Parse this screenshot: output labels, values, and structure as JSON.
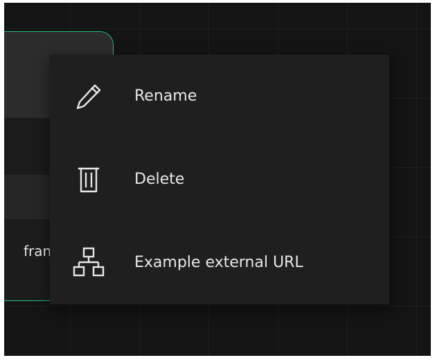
{
  "node": {
    "label": "fran"
  },
  "context_menu": {
    "items": [
      {
        "label": "Rename",
        "icon": "pencil-icon"
      },
      {
        "label": "Delete",
        "icon": "trash-icon"
      },
      {
        "label": "Example external URL",
        "icon": "sitemap-icon"
      }
    ]
  },
  "colors": {
    "canvas_background": "#141414",
    "grid_line": "#1f1f1f",
    "node_border_accent": "#22c17a",
    "menu_background": "#1f1f1f",
    "menu_text": "#e8e8e8"
  }
}
